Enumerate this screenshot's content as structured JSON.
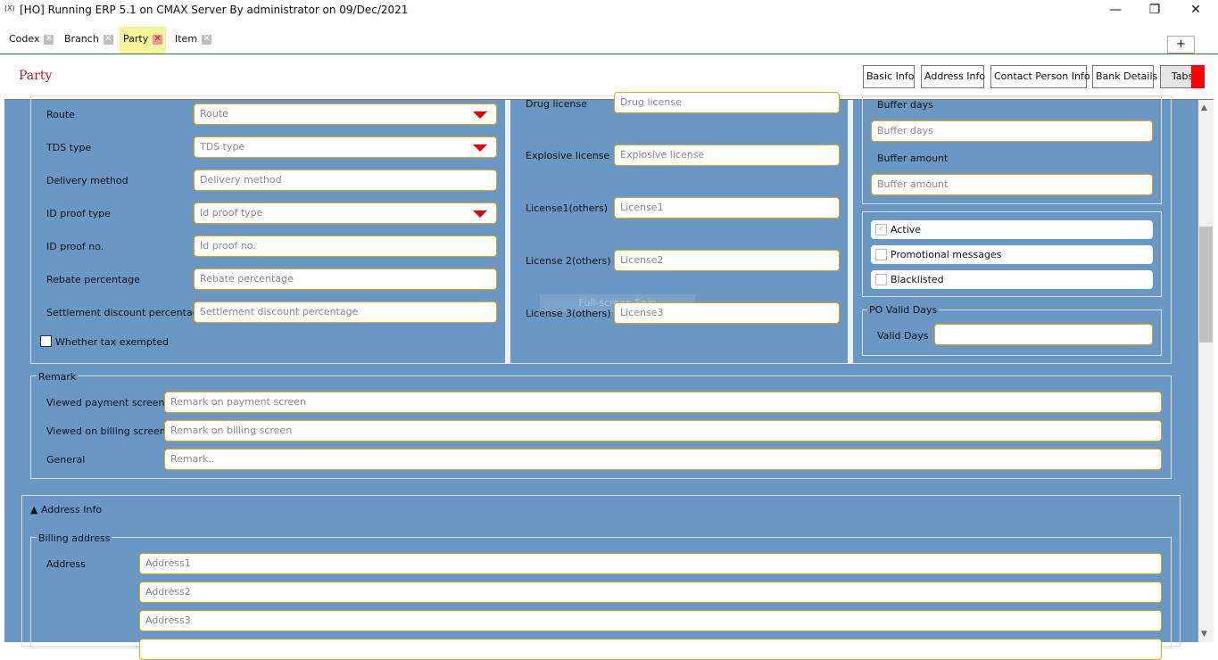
{
  "window": {
    "title": "[HO] Running ERP 5.1 on CMAX Server By administrator on 09/Dec/2021",
    "app_icon": "(X)",
    "minimize": "—",
    "restore": "❐",
    "close": "✕"
  },
  "tabs": [
    {
      "label": "Codex",
      "active": false
    },
    {
      "label": "Branch",
      "active": false
    },
    {
      "label": "Party",
      "active": true
    },
    {
      "label": "Item",
      "active": false
    }
  ],
  "tab_close_glyph": "✕",
  "add_tab_label": "+",
  "header": {
    "title": "Party",
    "buttons": [
      "Basic Info",
      "Address Info",
      "Contact Person Info",
      "Bank Details",
      "Tabs"
    ]
  },
  "left_fields": [
    {
      "label": "Route",
      "placeholder": "Route",
      "type": "dropdown"
    },
    {
      "label": "TDS type",
      "placeholder": "TDS type",
      "type": "dropdown"
    },
    {
      "label": "Delivery method",
      "placeholder": "Delivery method",
      "type": "text"
    },
    {
      "label": "ID proof type",
      "placeholder": "Id proof type",
      "type": "dropdown"
    },
    {
      "label": "ID proof no.",
      "placeholder": "Id proof no.",
      "type": "text"
    },
    {
      "label": "Rebate percentage",
      "placeholder": "Rebate percentage",
      "type": "text"
    },
    {
      "label": "Settlement discount percentage",
      "placeholder": "Settlement discount percentage",
      "type": "text"
    }
  ],
  "tax_exempted": {
    "label": "Whether tax exempted",
    "checked": false
  },
  "licenses": [
    {
      "label": "Drug license",
      "placeholder": "Drug license"
    },
    {
      "label": "Explosive license",
      "placeholder": "Explosive license"
    },
    {
      "label": "License1(others)",
      "placeholder": "License1"
    },
    {
      "label": "License 2(others)",
      "placeholder": "License2"
    },
    {
      "label": "License 3(others)",
      "placeholder": "License3"
    }
  ],
  "buffer": {
    "days_label": "Buffer days",
    "days_placeholder": "Buffer days",
    "amount_label": "Buffer amount",
    "amount_placeholder": "Buffer amount"
  },
  "flags": [
    {
      "label": "Active",
      "checked": true
    },
    {
      "label": "Promotional messages",
      "checked": false
    },
    {
      "label": "Blacklisted",
      "checked": false
    }
  ],
  "check_glyph": "✓",
  "po_valid": {
    "legend": "PO Valid Days",
    "label": "Valid Days",
    "value": ""
  },
  "remark": {
    "legend": "Remark",
    "rows": [
      {
        "label": "Viewed payment screen",
        "placeholder": "Remark on payment screen"
      },
      {
        "label": "Viewed on billing screen",
        "placeholder": "Remark on billing screen"
      },
      {
        "label": "General",
        "placeholder": "Remark.."
      }
    ]
  },
  "address_info": {
    "heading": "▲ Address Info",
    "billing_legend": "Billing address",
    "address_label": "Address",
    "placeholders": [
      "Address1",
      "Address2",
      "Address3",
      ""
    ]
  },
  "watermark": "Full-screen Snip",
  "scroll": {
    "up": "▲",
    "down": "▼"
  }
}
